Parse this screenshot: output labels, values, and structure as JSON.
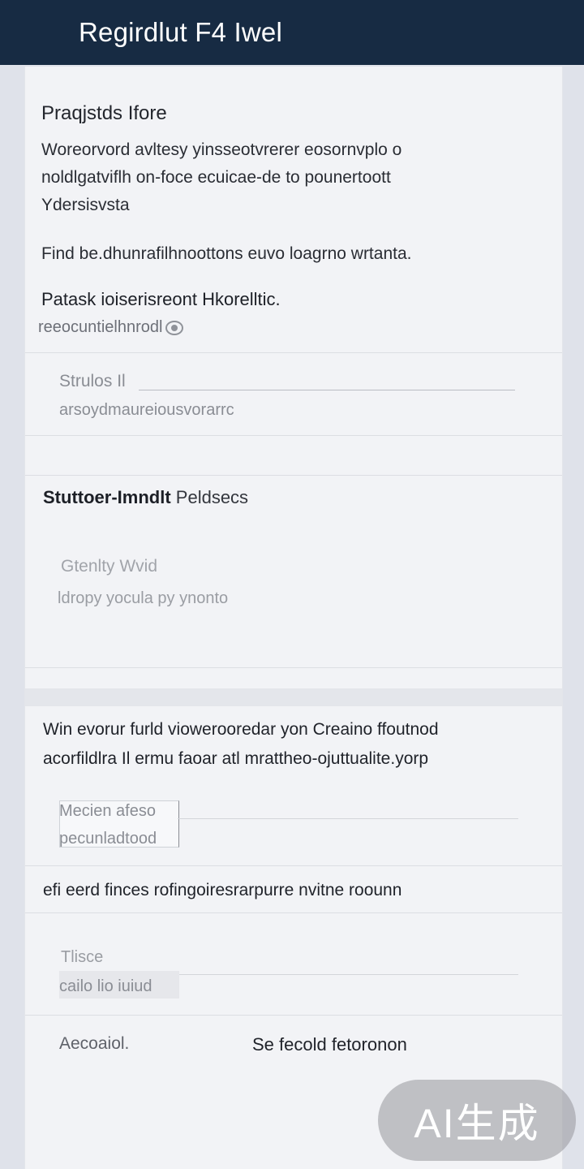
{
  "header": {
    "title": "Regirdlut F4 Iwel"
  },
  "intro": {
    "heading": "Praqjstds Ifore",
    "paragraph_lines": [
      "Woreorvord avltesy yinsseotvrerer eosornvplo o",
      "noldlgatviflh on-foce ecuicae-de to pounertoott",
      "Ydersisvsta"
    ],
    "note": "Find be.dhunrafilhnoottons euvo loagrno wrtanta.",
    "bold_line": "Patask ioiserisreont Hkorelltic.",
    "sub_line": "reeocuntielhnrodl"
  },
  "field_1": {
    "label": "Strulos Il",
    "value": "arsoydmaureiousvorarrc"
  },
  "section_2": {
    "title_bold": "Stuttoer-Imndlt",
    "title_rest": "Peldsecs",
    "field_label": "Gtenlty Wvid",
    "field_value": "ldropy yocula py ynonto"
  },
  "section_3": {
    "lines": [
      "Win evorur furld viowerooredar yon Creaino ffoutnod",
      "acorfildlra Il ermu faoar atl mrattheo-ojuttualite.yorp"
    ],
    "input_label": "Mecien afeso",
    "input_value": "pecunladtood"
  },
  "section_4": {
    "line": "efi eerd finces rofingoiresrarpurre nvitne roounn",
    "input_label": "Tlisce",
    "input_value": "cailo lio iuiud"
  },
  "footer": {
    "left_action": "Aecoaiol.",
    "right_action": "Se fecold fetoronon"
  },
  "watermark": {
    "text": "AI生成"
  }
}
